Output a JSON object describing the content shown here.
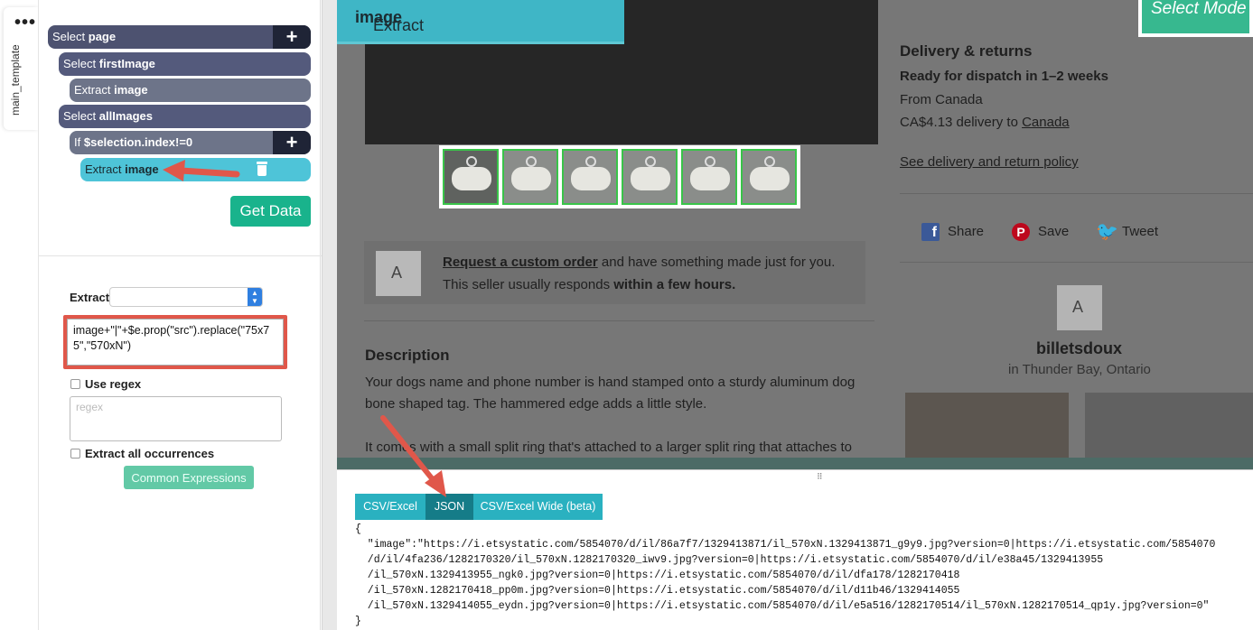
{
  "sidebar_tab": {
    "label": "main_template",
    "menu_icon": "ellipsis-icon"
  },
  "tree": {
    "nodes": [
      {
        "prefix": "Select",
        "name": "page"
      },
      {
        "prefix": "Select",
        "name": "firstImage"
      },
      {
        "prefix": "Extract",
        "name": "image"
      },
      {
        "prefix": "Select",
        "name": "allImages"
      },
      {
        "prefix": "If",
        "name": "$selection.index!=0"
      },
      {
        "prefix": "Extract",
        "name": "image"
      }
    ],
    "get_data_label": "Get Data"
  },
  "editor": {
    "extract_label": "Extract",
    "expression": "image+\"|\"+$e.prop(\"src\").replace(\"75x75\",\"570xN\")",
    "use_regex_label": "Use regex",
    "regex_placeholder": "regex",
    "extract_all_label": "Extract all occurrences",
    "common_expressions_label": "Common Expressions"
  },
  "webpage": {
    "overlay_title_prefix": "Extract",
    "overlay_title_name": "image",
    "mode_label": "Select Mode",
    "delivery": {
      "heading": "Delivery & returns",
      "dispatch": "Ready for dispatch in 1–2 weeks",
      "from": "From Canada",
      "cost_prefix": "CA$4.13 delivery to",
      "cost_country": "Canada",
      "policy_link": "See delivery and return policy"
    },
    "social": {
      "share": "Share",
      "save": "Save",
      "tweet": "Tweet"
    },
    "custom_order": {
      "link": "Request a custom order",
      "rest": " and have something made just for you.",
      "response_prefix": "This seller usually responds",
      "response_bold": "within a few hours."
    },
    "description": {
      "heading": "Description",
      "line1": "Your dogs name and phone number is hand stamped onto a sturdy aluminum dog",
      "line2": "bone shaped tag. The hammered edge adds a little style.",
      "line3": "It comes with a small split ring that's attached to a larger split ring that attaches to"
    },
    "shop": {
      "name": "billetsdoux",
      "location": "in Thunder Bay, Ontario",
      "avatar_letter": "A"
    },
    "thumbnails_count": 6
  },
  "data_panel": {
    "tabs": [
      "CSV/Excel",
      "JSON",
      "CSV/Excel Wide (beta)"
    ],
    "active_tab": "JSON",
    "json_lines": [
      "{",
      "  \"image\":\"https://i.etsystatic.com/5854070/d/il/86a7f7/1329413871/il_570xN.1329413871_g9y9.jpg?version=0|https://i.etsystatic.com/5854070",
      "  /d/il/4fa236/1282170320/il_570xN.1282170320_iwv9.jpg?version=0|https://i.etsystatic.com/5854070/d/il/e38a45/1329413955",
      "  /il_570xN.1329413955_ngk0.jpg?version=0|https://i.etsystatic.com/5854070/d/il/dfa178/1282170418",
      "  /il_570xN.1282170418_pp0m.jpg?version=0|https://i.etsystatic.com/5854070/d/il/d11b46/1329414055",
      "  /il_570xN.1329414055_eydn.jpg?version=0|https://i.etsystatic.com/5854070/d/il/e5a516/1282170514/il_570xN.1282170514_qp1y.jpg?version=0\"",
      "}"
    ]
  }
}
